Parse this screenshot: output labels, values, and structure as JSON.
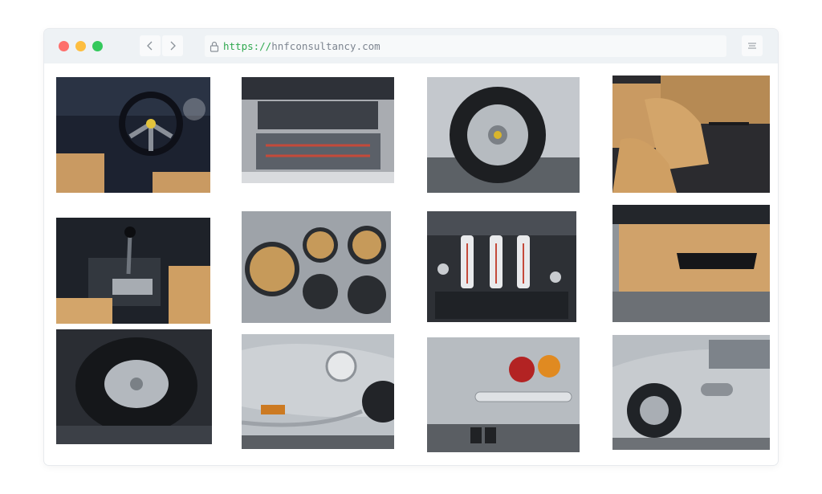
{
  "browser": {
    "url_scheme": "https://",
    "url_host": "hnfconsultancy.com",
    "icons": {
      "back": "chevron-left-icon",
      "forward": "chevron-right-icon",
      "lock": "lock-icon",
      "menu": "menu-icon"
    },
    "colors": {
      "close": "#fe6f6c",
      "minimize": "#fdbe40",
      "maximize": "#34c95c",
      "scheme": "#2fa84f"
    }
  },
  "gallery": {
    "photos": [
      "steering-wheel-interior",
      "engine-bay",
      "alloy-wheel",
      "tan-leather-seats",
      "gear-shifter-console",
      "gauge-cluster",
      "dashboard-switches",
      "door-panel",
      "spare-tire-trunk",
      "front-headlight",
      "rear-tail-lights",
      "side-body-wheel"
    ]
  }
}
